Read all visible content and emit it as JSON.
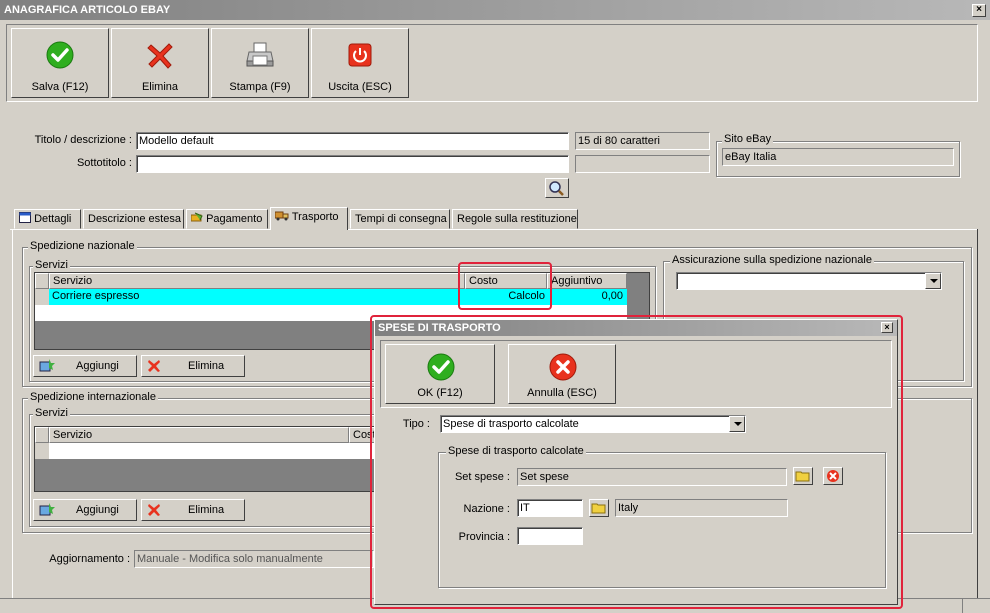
{
  "window": {
    "title": "ANAGRAFICA ARTICOLO EBAY",
    "close": "×"
  },
  "toolbar": {
    "save": "Salva (F12)",
    "delete": "Elimina",
    "print": "Stampa (F9)",
    "exit": "Uscita (ESC)"
  },
  "form": {
    "title_label": "Titolo / descrizione :",
    "title_value": "Modello default",
    "title_count": "15 di 80 caratteri",
    "subtitle_label": "Sottotitolo :",
    "subtitle_value": "",
    "site_group": "Sito eBay",
    "site_value": "eBay Italia"
  },
  "tabs": [
    "Dettagli",
    "Descrizione estesa",
    "Pagamento",
    "Trasporto",
    "Tempi di consegna",
    "Regole sulla restituzione"
  ],
  "national": {
    "group": "Spedizione nazionale",
    "services_group": "Servizi",
    "columns": [
      "Servizio",
      "Costo",
      "Aggiuntivo"
    ],
    "rows": [
      {
        "service": "Corriere espresso",
        "cost": "Calcolo",
        "extra": "0,00"
      }
    ],
    "add": "Aggiungi",
    "delete": "Elimina",
    "insurance_group": "Assicurazione sulla spedizione nazionale",
    "insurance_value": ""
  },
  "international": {
    "group": "Spedizione internazionale",
    "services_group": "Servizi",
    "columns": [
      "Servizio",
      "Cost"
    ],
    "add": "Aggiungi",
    "delete": "Elimina"
  },
  "update": {
    "label": "Aggiornamento :",
    "value": "Manuale - Modifica solo manualmente"
  },
  "dialog": {
    "title": "SPESE DI TRASPORTO",
    "close": "×",
    "ok": "OK (F12)",
    "cancel": "Annulla (ESC)",
    "type_label": "Tipo :",
    "type_value": "Spese di trasporto calcolate",
    "group": "Spese di trasporto calcolate",
    "set_label": "Set spese :",
    "set_value": "Set spese",
    "country_label": "Nazione :",
    "country_code": "IT",
    "country_name": "Italy",
    "province_label": "Provincia :",
    "province_value": ""
  },
  "colors": {
    "selected_row": "#00ffff",
    "highlight": "#e0233b",
    "titlebar": "#808080"
  }
}
